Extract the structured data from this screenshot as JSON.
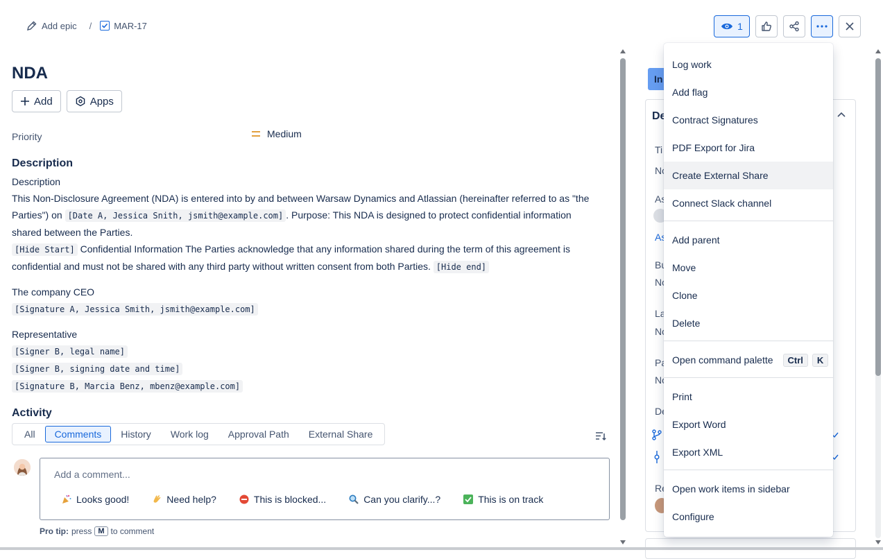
{
  "breadcrumb": {
    "epic_label": "Add epic",
    "sep": "/",
    "issue_key": "MAR-17"
  },
  "header": {
    "watch_count": "1"
  },
  "issue": {
    "title": "NDA",
    "add_label": "Add",
    "apps_label": "Apps",
    "priority_label": "Priority",
    "priority_value": "Medium"
  },
  "description": {
    "heading": "Description",
    "subheading": "Description",
    "p1_a": "This Non-Disclosure Agreement (NDA) is entered into by and between Warsaw Dynamics and Atlassian (hereinafter referred to as \"the Parties\") on ",
    "p1_code": "[Date A, Jessica Snith, jsmith@example.com]",
    "p1_b": ". Purpose: This NDA is designed to protect confidential information shared between the Parties.",
    "p2_code1": "[Hide Start]",
    "p2_text": " Confidential Information The Parties acknowledge that any information shared during the term of this agreement is confidential and must not be shared with any third party without written consent from both Parties. ",
    "p2_code2": "[Hide end]",
    "ceo_label": "The company CEO",
    "ceo_sig": "[Signature A, Jessica Smith, jsmith@example.com]",
    "rep_label": "Representative",
    "rep_line1": "[Signer B, legal name]",
    "rep_line2": "[Signer B, signing date and time]",
    "rep_line3": "[Signature B, Marcia Benz, mbenz@example.com]"
  },
  "activity": {
    "heading": "Activity",
    "tabs": [
      "All",
      "Comments",
      "History",
      "Work log",
      "Approval Path",
      "External Share"
    ],
    "comment_placeholder": "Add a comment...",
    "quick_replies": [
      "Looks good!",
      "Need help?",
      "This is blocked...",
      "Can you clarify...?",
      "This is on track"
    ],
    "protip_label": "Pro tip:",
    "protip_press": "press",
    "protip_key": "M",
    "protip_suffix": "to comment"
  },
  "right_panel": {
    "status": "In",
    "heading": "De",
    "frag": [
      "Ti",
      "No",
      "As",
      "As",
      "Bu",
      "No",
      "La",
      "No",
      "Pa",
      "No",
      "De",
      "Re"
    ]
  },
  "menu": {
    "items": [
      "Log work",
      "Add flag",
      "Contract Signatures",
      "PDF Export for Jira",
      "Create External Share",
      "Connect Slack channel",
      "Add parent",
      "Move",
      "Clone",
      "Delete",
      "Open command palette",
      "Print",
      "Export Word",
      "Export XML",
      "Open work items in sidebar",
      "Configure"
    ],
    "shortcut_keys": [
      "Ctrl",
      "K"
    ]
  },
  "colors": {
    "accent": "#1868db",
    "status_badge": "#669df1",
    "priority_medium": "#e2a03f"
  }
}
